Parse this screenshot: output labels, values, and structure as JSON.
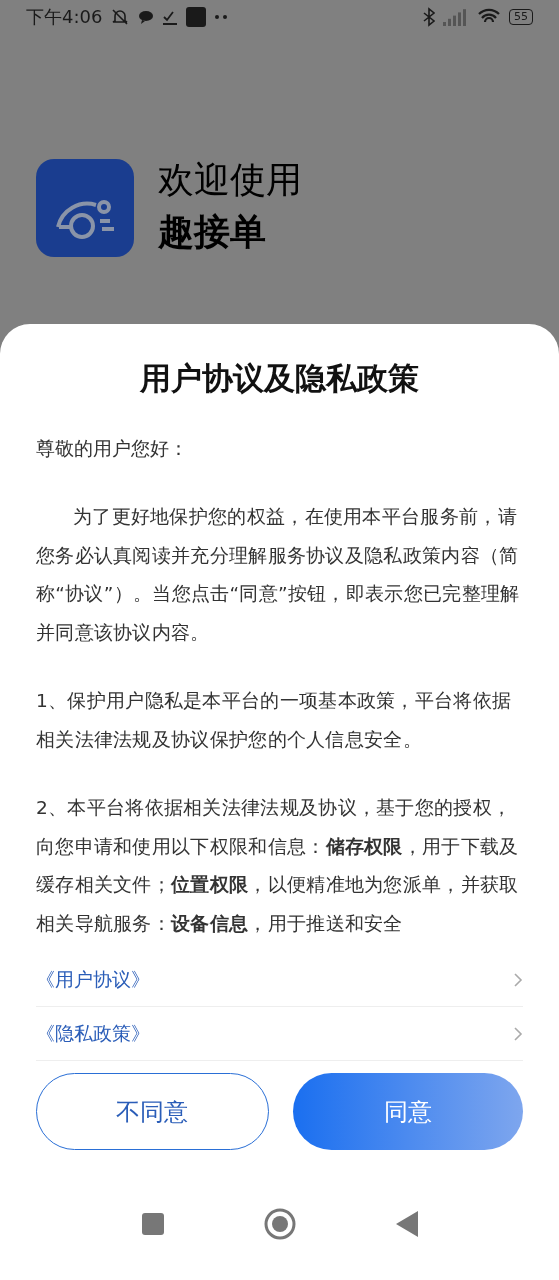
{
  "status_bar": {
    "time": "下午4:06",
    "battery": "55"
  },
  "header": {
    "welcome": "欢迎使用",
    "app_name": "趣接单"
  },
  "dialog": {
    "title": "用户协议及隐私政策",
    "greeting": "尊敬的用户您好：",
    "paragraphs": [
      {
        "text": "为了更好地保护您的权益，在使用本平台服务前，请您务必认真阅读并充分理解服务协议及隐私政策内容（简称“协议”）。当您点击“同意”按钮，即表示您已完整理解并同意该协议内容。",
        "indent": true
      },
      {
        "text": "1、保护用户隐私是本平台的一项基本政策，平台将依据相关法律法规及协议保护您的个人信息安全。",
        "indent": false
      },
      {
        "text": "2、本平台将依据相关法律法规及协议，基于您的授权，向您申请和使用以下权限和信息：**储存权限**，用于下载及缓存相关文件；**位置权限**，以便精准地为您派单，并获取相关导航服务：**设备信息**，用于推送和安全",
        "indent": false
      }
    ],
    "links": [
      {
        "label": "《用户协议》"
      },
      {
        "label": "《隐私政策》"
      }
    ],
    "buttons": [
      {
        "label": "不同意",
        "kind": "secondary"
      },
      {
        "label": "同意",
        "kind": "primary"
      }
    ]
  }
}
